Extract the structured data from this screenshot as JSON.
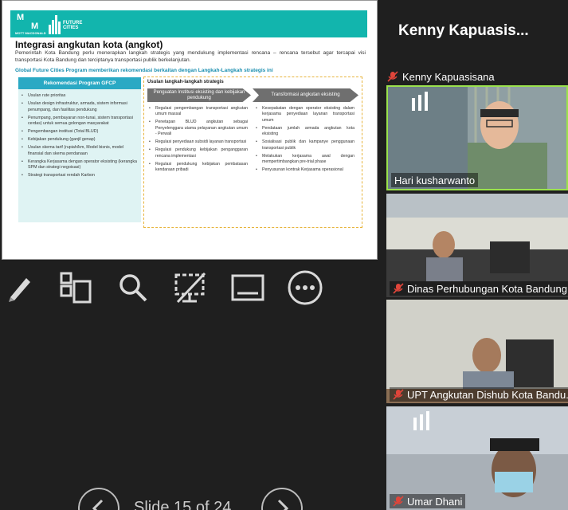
{
  "slide": {
    "logo_mm_text": "MOTT MACDONALD",
    "logo_fc_text": "FUTURE CITIES",
    "title": "Integrasi angkutan kota (angkot)",
    "intro": "Pemerintah Kota Bandung perlu menerapkan langkah strategis yang mendukung implementasi rencana – rencana tersebut agar tercapai visi transportasi Kota Bandung dan terciptanya transportasi publik berkelanjutan.",
    "subtitle": "Global Future Cities Program memberikan rekomendasi berkaitan dengan Langkah-Langkah strategis ini",
    "left_panel": {
      "header": "Rekomendasi Program GFCP",
      "items": [
        "Usulan rute prioritas",
        "Usulan design infrastruktur, armada, sistem informasi penumpang, dan fasilitas pendukung",
        "Penumpang, pembayaran non-tunai, sistem transportasi cerdas) untuk semua golongan masyarakat",
        "Pengembangan institusi (Total BLUD)",
        "Kebijakan pendukung (ganjil genap)",
        "Usulan skema tarif (rupiah/km, Model bisnis, model finansial dan skema pendanaan",
        "Kerangka Kerjasama dengan operator eksisting (kerangka SPM dan strategi negoisasi)",
        "Strategi transportasi rendah Karbon"
      ]
    },
    "right_panel": {
      "header": "Usulan langkah-langkah strategis",
      "col1_title": "Penguatan Institusi eksisting dan kebijakan pendukung",
      "col2_title": "Transformasi angkutan eksisting",
      "col1_items": [
        "Regulasi pengembangan transportasi angkutan umum massal",
        "Penetapan BLUD angkutan sebagai Penyelenggara utama pelayanan angkutan umum - Perwali",
        "Regulasi penyediaan subsidi layanan transportasi",
        "Regulasi pendukung kebijakan penganggaran rencana implementasi",
        "Regulasi pendukung kebijakan pembatasan kendaraan pribadi"
      ],
      "col2_items": [
        "Kesepakatan dengan operator eksisting dalam kerjasama penyediaan layanan transportasi umum",
        "Pendataan jumlah armada angkutan kota eksisting",
        "Sosialisasi publik dan kampanye penggunaan transportasi publik",
        "Melakukan kerjasama awal dengan mempertimbangkan pre-trial phase",
        "Penyusunan kontrak Kerjasama operasional"
      ]
    }
  },
  "toolbar": {
    "icons": [
      "pen-icon",
      "layout-icon",
      "zoom-icon",
      "screen-off-icon",
      "caption-icon",
      "more-icon"
    ]
  },
  "nav": {
    "counter": "Slide 15 of 24"
  },
  "participants": {
    "speaker": "Kenny  Kapuasis...",
    "kenny_label": "Kenny Kapuasisana",
    "tiles": [
      {
        "name": "Hari kusharwanto",
        "muted": false
      },
      {
        "name": "Dinas Perhubungan Kota Bandung",
        "muted": true
      },
      {
        "name": "UPT Angkutan Dishub Kota Bandu...",
        "muted": true
      },
      {
        "name": "Umar Dhani",
        "muted": true
      }
    ]
  },
  "colors": {
    "teal_header": "#12b5ad",
    "panel_blue": "#2aa9c4",
    "dashed_border": "#e7b43b",
    "active_speaker": "#9be24d",
    "muted_red": "#e0453a"
  }
}
